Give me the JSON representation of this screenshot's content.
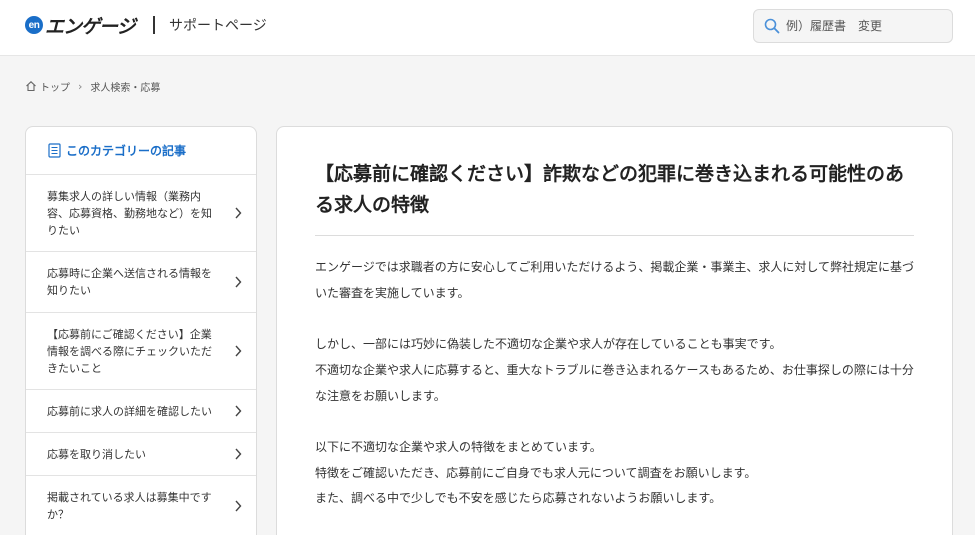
{
  "header": {
    "logo_mark": "en",
    "logo_text": "エンゲージ",
    "logo_sub": "サポートページ",
    "search_placeholder": "例）履歴書　変更"
  },
  "breadcrumb": {
    "items": [
      "トップ",
      "求人検索・応募"
    ]
  },
  "sidebar": {
    "heading": "このカテゴリーの記事",
    "items": [
      {
        "label": "募集求人の詳しい情報（業務内容、応募資格、勤務地など）を知りたい"
      },
      {
        "label": "応募時に企業へ送信される情報を知りたい"
      },
      {
        "label": "【応募前にご確認ください】企業情報を調べる際にチェックいただきたいこと"
      },
      {
        "label": "応募前に求人の詳細を確認したい"
      },
      {
        "label": "応募を取り消したい"
      },
      {
        "label": "掲載されている求人は募集中ですか？"
      }
    ]
  },
  "article": {
    "title": "【応募前に確認ください】詐欺などの犯罪に巻き込まれる可能性のある求人の特徴",
    "paragraphs": [
      [
        "エンゲージでは求職者の方に安心してご利用いただけるよう、掲載企業・事業主、求人に対して弊社規定に基づいた審査を実施しています。"
      ],
      [
        "しかし、一部には巧妙に偽装した不適切な企業や求人が存在していることも事実です。",
        "不適切な企業や求人に応募すると、重大なトラブルに巻き込まれるケースもあるため、お仕事探しの際には十分な注意をお願いします。"
      ],
      [
        "以下に不適切な企業や求人の特徴をまとめています。",
        "特徴をご確認いただき、応募前にご自身でも求人元について調査をお願いします。",
        "また、調べる中で少しでも不安を感じたら応募されないようお願いします。"
      ]
    ]
  },
  "colors": {
    "accent": "#1a6ec8",
    "background": "#f5f5f5",
    "border": "#dcdcdc"
  }
}
